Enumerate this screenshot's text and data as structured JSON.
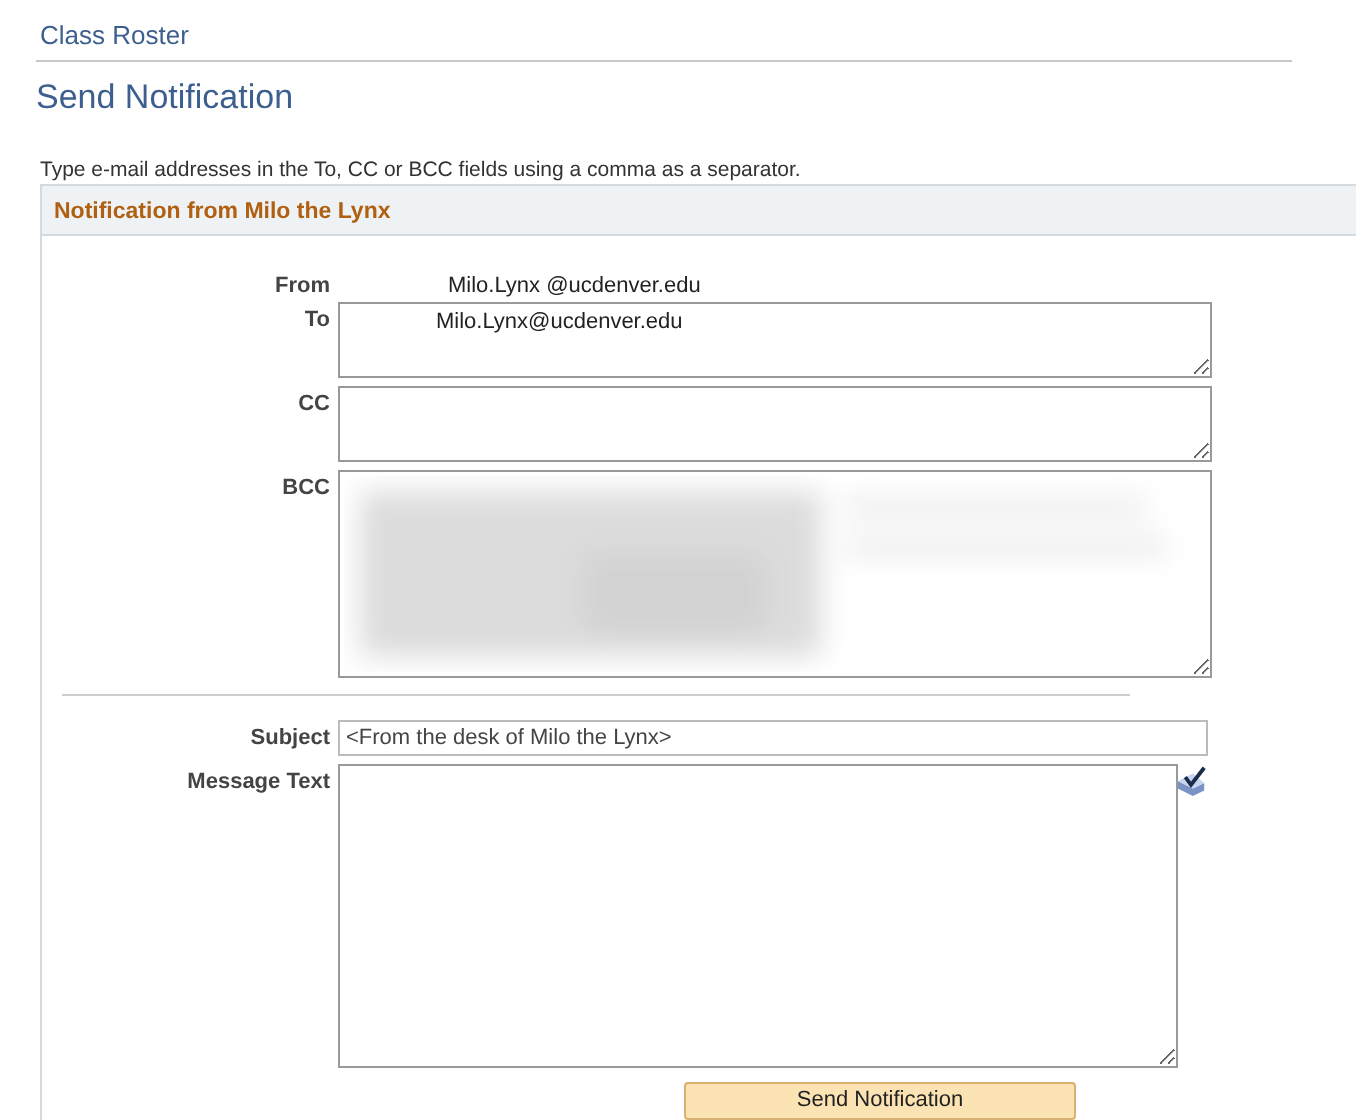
{
  "breadcrumb": "Class Roster",
  "page_title": "Send Notification",
  "instructions": "Type e-mail addresses in the To, CC or BCC fields using a comma as a separator.",
  "group": {
    "title": "Notification from Milo the Lynx"
  },
  "from": {
    "label": "From",
    "value": "Milo.Lynx @ucdenver.edu"
  },
  "to": {
    "label": "To",
    "value": "Milo.Lynx@ucdenver.edu"
  },
  "cc": {
    "label": "CC"
  },
  "bcc": {
    "label": "BCC",
    "redacted": true
  },
  "subject": {
    "label": "Subject",
    "value": "<From the desk of Milo the Lynx>"
  },
  "message": {
    "label": "Message Text"
  },
  "send_button": "Send Notification"
}
